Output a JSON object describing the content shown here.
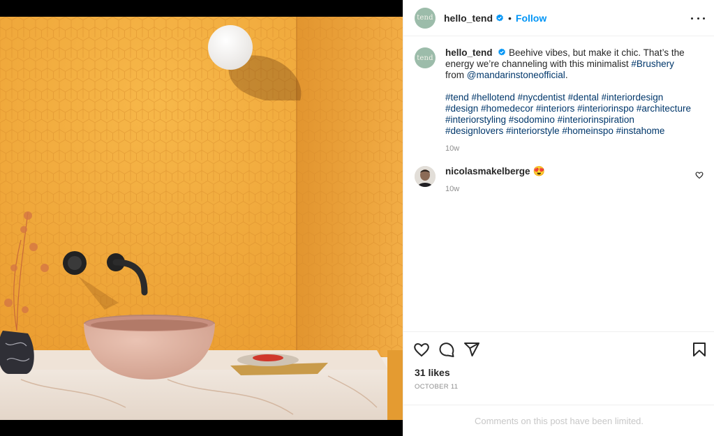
{
  "post": {
    "author": "hello_tend",
    "avatar_text": "tend",
    "follow_label": "Follow",
    "separator": "•",
    "caption_text": "Beehive vibes, but make it chic. That’s the energy we’re channeling with this minimalist",
    "caption_link1": "#Brushery",
    "caption_from": "from",
    "caption_link2": "@mandarinstoneofficial",
    "caption_end": ".",
    "hashtags": "#tend #hellotend #nycdentist #dental #interiordesign #design #homedecor #interiors #interiorinspo #architecture #interiorstyling #sodomino #interiorinspiration #designlovers #interiorstyle #homeinspo #instahome",
    "caption_time": "10w",
    "likes": "31 likes",
    "date": "OCTOBER 11",
    "comments_limited": "Comments on this post have been limited."
  },
  "comment": {
    "user": "nicolasmakelberge",
    "emoji": "😍",
    "time": "10w"
  },
  "icons": {
    "verified": "verified-badge-icon",
    "more": "more-options-icon",
    "like": "heart-icon",
    "comment": "comment-icon",
    "share": "paper-plane-icon",
    "save": "bookmark-icon"
  },
  "colors": {
    "accent": "#0095f6",
    "link": "#00376b",
    "muted": "#8e8e8e",
    "tile": "#f0a73a"
  }
}
